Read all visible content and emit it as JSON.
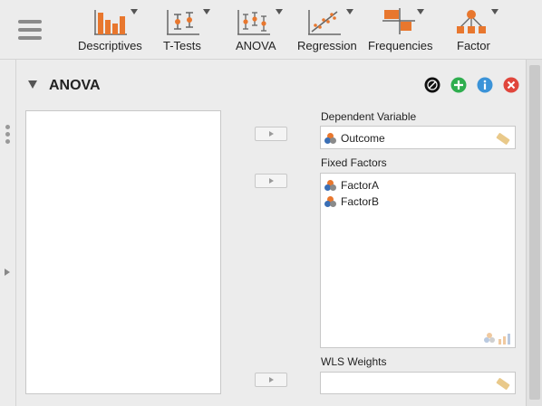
{
  "toolbar": {
    "items": [
      {
        "label": "Descriptives"
      },
      {
        "label": "T-Tests"
      },
      {
        "label": "ANOVA"
      },
      {
        "label": "Regression"
      },
      {
        "label": "Frequencies"
      },
      {
        "label": "Factor"
      }
    ]
  },
  "analysis": {
    "title": "ANOVA"
  },
  "dependent": {
    "label": "Dependent Variable",
    "value": "Outcome"
  },
  "fixed_factors": {
    "label": "Fixed Factors",
    "items": [
      "FactorA",
      "FactorB"
    ]
  },
  "wls": {
    "label": "WLS Weights"
  },
  "colors": {
    "accent_orange": "#e8772e",
    "help_blue": "#3b93d8",
    "add_green": "#2fae4f",
    "close_red": "#e0463c"
  }
}
